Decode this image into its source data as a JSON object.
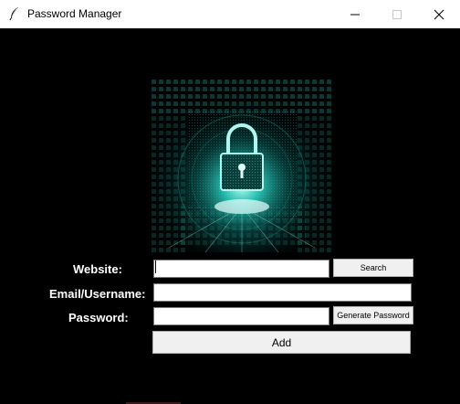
{
  "window": {
    "title": "Password Manager",
    "icon": "feather-icon",
    "controls": [
      "minimize-icon",
      "maximize-icon",
      "close-icon"
    ]
  },
  "hero": {
    "image": "padlock-cyber-image"
  },
  "form": {
    "website_label": "Website:",
    "website_value": "",
    "email_label": "Email/Username:",
    "email_value": "",
    "password_label": "Password:",
    "password_value": "",
    "search_button": "Search",
    "generate_button": "Generate Password",
    "add_button": "Add"
  },
  "colors": {
    "background": "#000000",
    "accent": "#2fe0d0",
    "button_face": "#f0f0f0"
  }
}
